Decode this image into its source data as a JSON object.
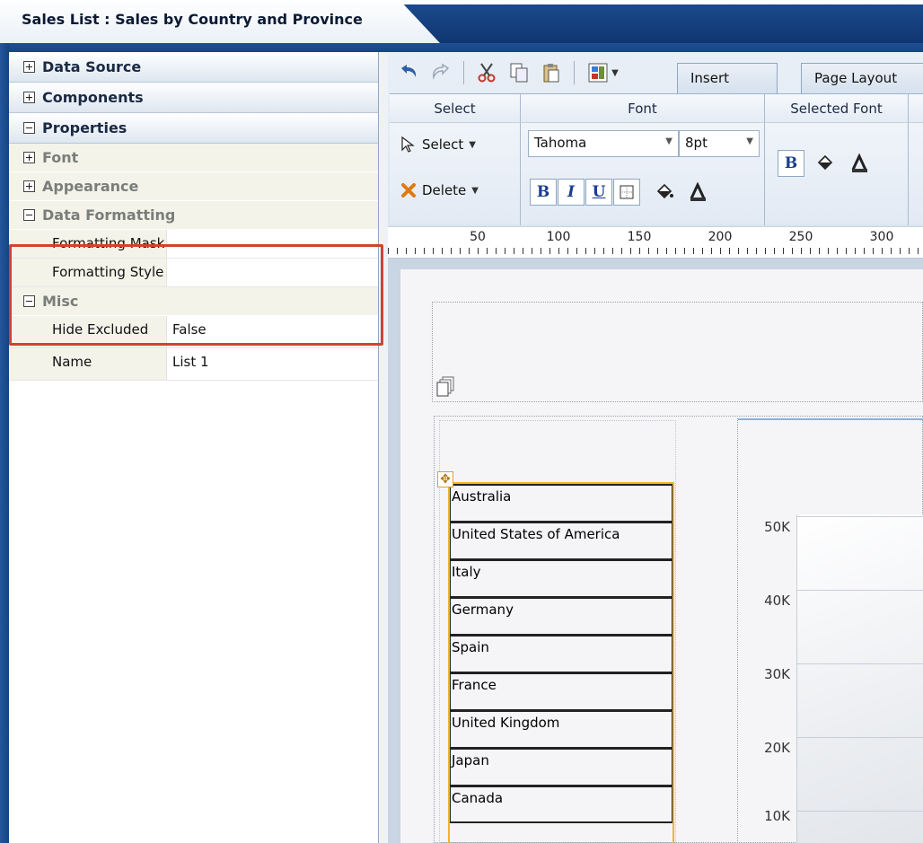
{
  "title": "Sales List : Sales by Country and Province",
  "left_panel": {
    "sections": [
      {
        "label": "Data Source",
        "state": "collapsed"
      },
      {
        "label": "Components",
        "state": "collapsed"
      },
      {
        "label": "Properties",
        "state": "expanded"
      }
    ],
    "groups": {
      "font": "Font",
      "appearance": "Appearance",
      "data_formatting": "Data Formatting",
      "misc": "Misc"
    },
    "data_formatting_rows": [
      {
        "name": "Formatting Mask",
        "value": ""
      },
      {
        "name": "Formatting Style",
        "value": ""
      }
    ],
    "misc_rows": [
      {
        "name": "Hide Excluded",
        "value": "False"
      },
      {
        "name": "Name",
        "value": "List 1"
      }
    ],
    "highlight_color": "#d0432f"
  },
  "ribbon": {
    "tabs": [
      "Insert",
      "Page Layout"
    ],
    "groups": {
      "select": "Select",
      "font": "Font",
      "selected_font": "Selected Font"
    },
    "select_label": "Select",
    "delete_label": "Delete",
    "font_family": "Tahoma",
    "font_size": "8pt",
    "bold_label": "B",
    "italic_label": "I",
    "underline_label": "U",
    "selected_bold_label": "B"
  },
  "ruler": {
    "marks": [
      "50",
      "100",
      "150",
      "200",
      "250",
      "300"
    ]
  },
  "list_component": {
    "items": [
      "Australia",
      "United States of America",
      "Italy",
      "Germany",
      "Spain",
      "France",
      "United Kingdom",
      "Japan",
      "Canada"
    ],
    "border_color": "#f1b52a"
  },
  "chart": {
    "y_ticks": [
      "50K",
      "40K",
      "30K",
      "20K",
      "10K"
    ]
  }
}
